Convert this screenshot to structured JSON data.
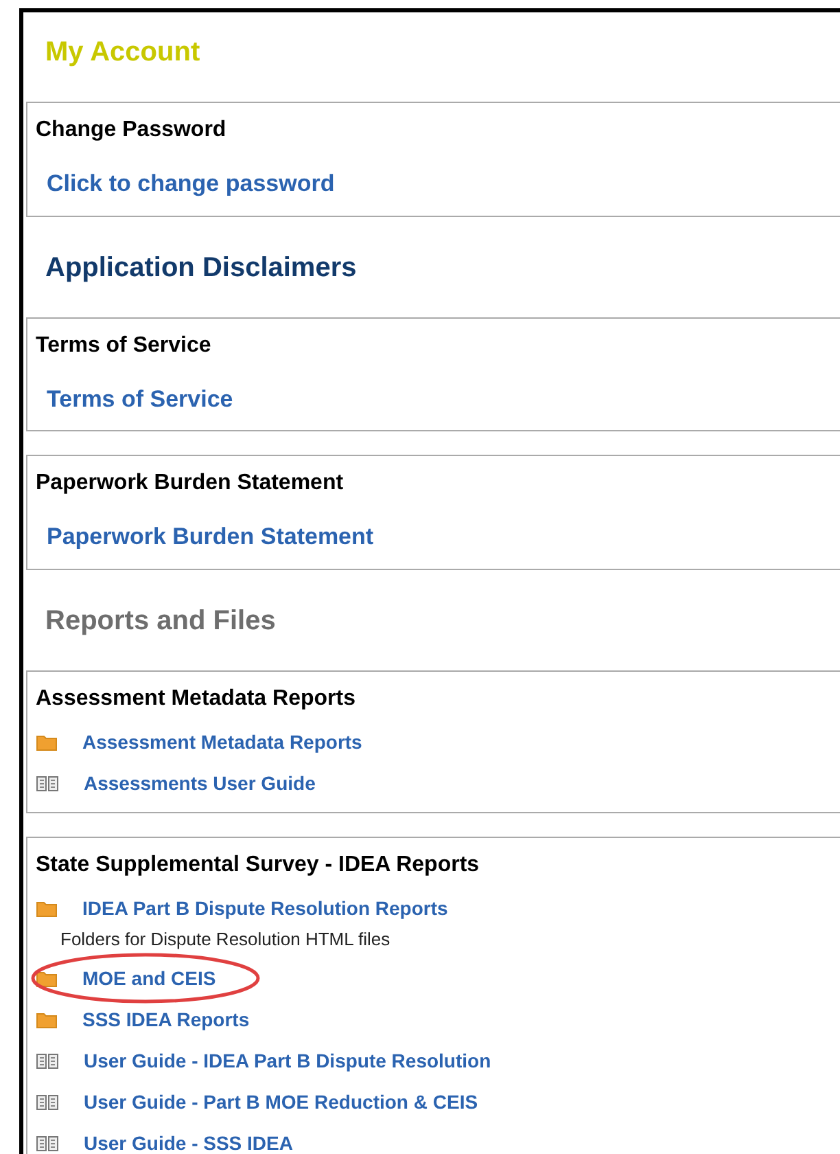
{
  "sections": [
    {
      "heading": "My Account",
      "color": "#c8c800",
      "cards": [
        {
          "title": "Change Password",
          "items": [
            {
              "kind": "link",
              "label": "Click to change password"
            }
          ]
        }
      ]
    },
    {
      "heading": "Application Disclaimers",
      "color": "#123a6b",
      "cards": [
        {
          "title": "Terms of Service",
          "items": [
            {
              "kind": "link",
              "label": "Terms of Service"
            }
          ]
        },
        {
          "title": "Paperwork Burden Statement",
          "items": [
            {
              "kind": "link",
              "label": "Paperwork Burden Statement"
            }
          ]
        }
      ]
    },
    {
      "heading": "Reports and Files",
      "color": "#6e6e6e",
      "cards": [
        {
          "title": "Assessment Metadata Reports",
          "items": [
            {
              "kind": "folder",
              "label": "Assessment Metadata Reports",
              "highlighted": false
            },
            {
              "kind": "guide",
              "label": "Assessments User Guide",
              "highlighted": false
            }
          ]
        },
        {
          "title": "State Supplemental Survey - IDEA Reports",
          "items": [
            {
              "kind": "folder",
              "label": "IDEA Part B Dispute Resolution Reports",
              "description": "Folders for Dispute Resolution HTML files",
              "highlighted": false
            },
            {
              "kind": "folder",
              "label": "MOE and CEIS",
              "highlighted": true
            },
            {
              "kind": "folder",
              "label": "SSS IDEA Reports",
              "highlighted": false
            },
            {
              "kind": "guide",
              "label": "User Guide - IDEA Part B Dispute Resolution",
              "highlighted": false
            },
            {
              "kind": "guide",
              "label": "User Guide - Part B MOE Reduction & CEIS",
              "highlighted": false
            },
            {
              "kind": "guide",
              "label": "User Guide - SSS IDEA",
              "highlighted": false
            }
          ]
        }
      ]
    }
  ]
}
